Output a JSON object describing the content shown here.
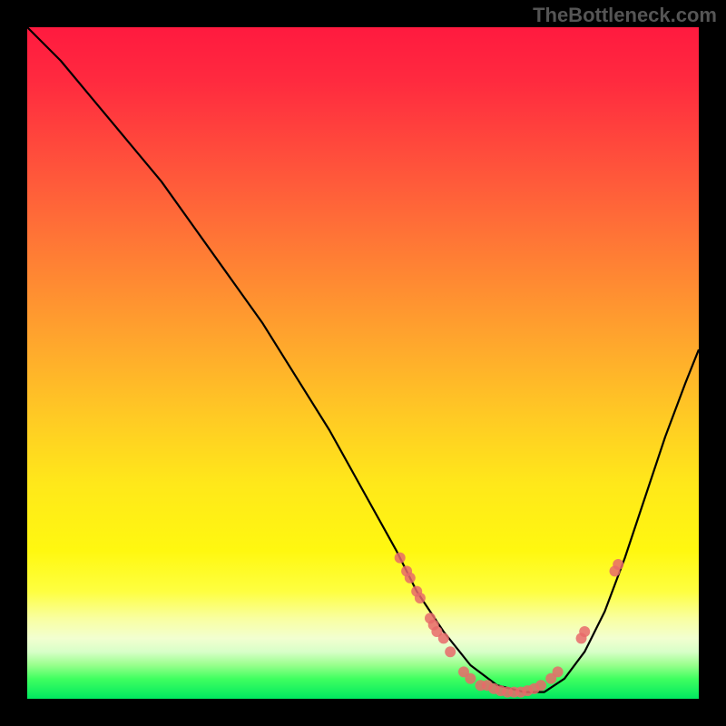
{
  "watermark": "TheBottleneck.com",
  "chart_data": {
    "type": "line",
    "title": "",
    "xlabel": "",
    "ylabel": "",
    "xlim": [
      0,
      100
    ],
    "ylim": [
      0,
      100
    ],
    "series": [
      {
        "name": "curve",
        "x": [
          0,
          5,
          10,
          15,
          20,
          25,
          30,
          35,
          40,
          45,
          50,
          55,
          58,
          62,
          66,
          70,
          74,
          77,
          80,
          83,
          86,
          89,
          92,
          95,
          98,
          100
        ],
        "y": [
          100,
          95,
          89,
          83,
          77,
          70,
          63,
          56,
          48,
          40,
          31,
          22,
          16,
          10,
          5,
          2,
          1,
          1,
          3,
          7,
          13,
          21,
          30,
          39,
          47,
          52
        ]
      }
    ],
    "markers": [
      {
        "x": 55.5,
        "y": 21
      },
      {
        "x": 56.5,
        "y": 19
      },
      {
        "x": 57.0,
        "y": 18
      },
      {
        "x": 58.0,
        "y": 16
      },
      {
        "x": 58.5,
        "y": 15
      },
      {
        "x": 60.0,
        "y": 12
      },
      {
        "x": 60.5,
        "y": 11
      },
      {
        "x": 61.0,
        "y": 10
      },
      {
        "x": 62.0,
        "y": 9
      },
      {
        "x": 63.0,
        "y": 7
      },
      {
        "x": 65.0,
        "y": 4
      },
      {
        "x": 66.0,
        "y": 3
      },
      {
        "x": 67.5,
        "y": 2
      },
      {
        "x": 68.5,
        "y": 2
      },
      {
        "x": 69.5,
        "y": 1.5
      },
      {
        "x": 70.5,
        "y": 1.2
      },
      {
        "x": 71.5,
        "y": 1
      },
      {
        "x": 72.5,
        "y": 1
      },
      {
        "x": 73.5,
        "y": 1
      },
      {
        "x": 74.5,
        "y": 1.2
      },
      {
        "x": 75.5,
        "y": 1.5
      },
      {
        "x": 76.5,
        "y": 2
      },
      {
        "x": 78.0,
        "y": 3
      },
      {
        "x": 79.0,
        "y": 4
      },
      {
        "x": 82.5,
        "y": 9
      },
      {
        "x": 83.0,
        "y": 10
      },
      {
        "x": 87.5,
        "y": 19
      },
      {
        "x": 88.0,
        "y": 20
      }
    ],
    "gradient_stops": [
      {
        "pos": 0.0,
        "color": "#ff1a3f"
      },
      {
        "pos": 0.5,
        "color": "#ffc020"
      },
      {
        "pos": 0.85,
        "color": "#feff40"
      },
      {
        "pos": 1.0,
        "color": "#00e860"
      }
    ]
  }
}
